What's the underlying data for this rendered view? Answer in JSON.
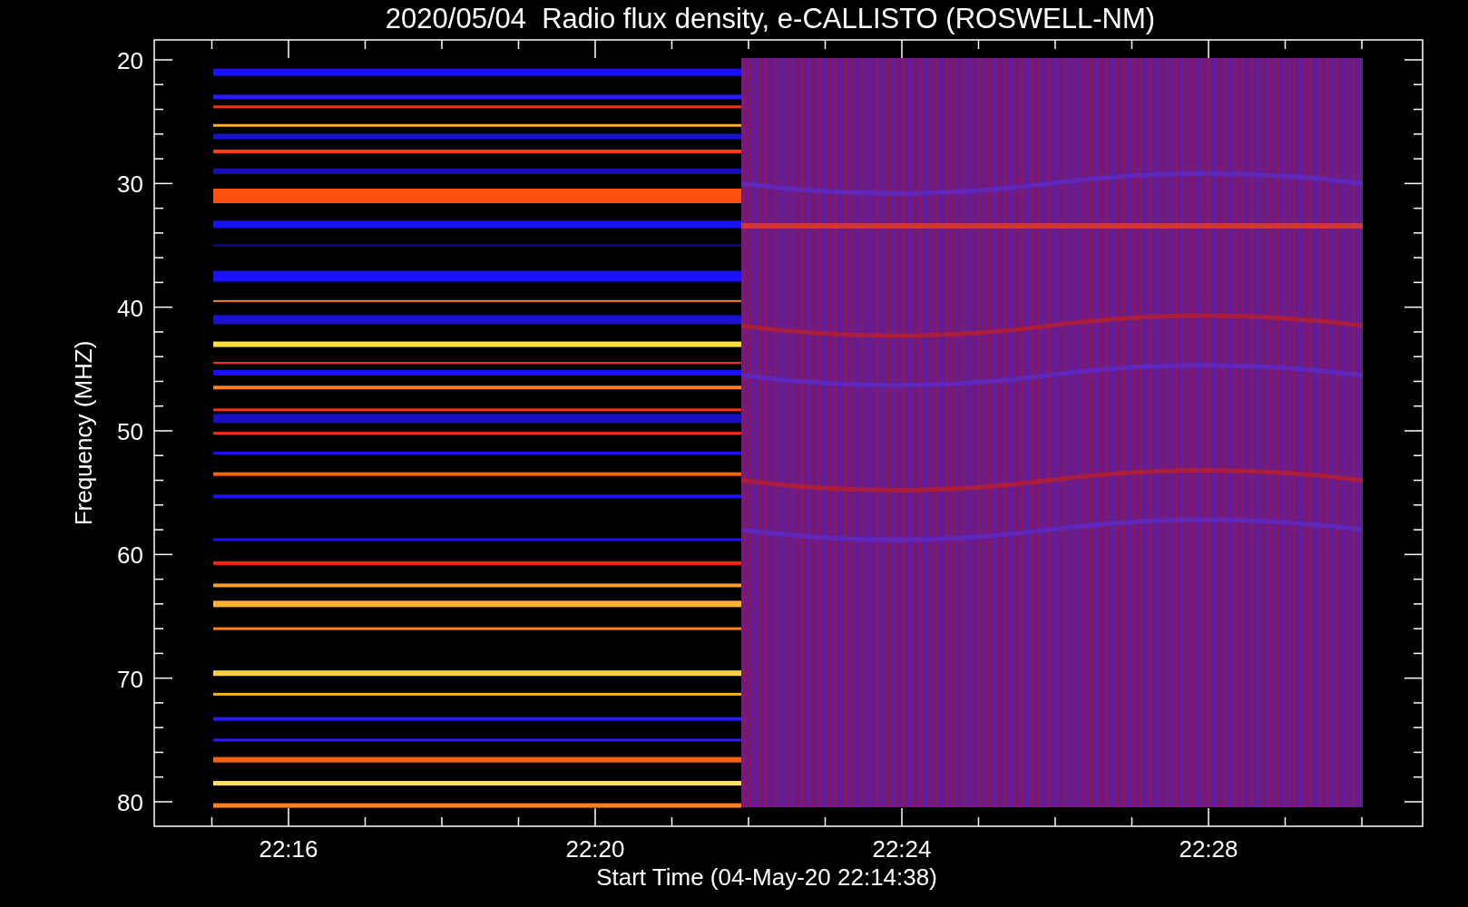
{
  "plot": {
    "title": "2020/05/04  Radio flux density, e-CALLISTO (ROSWELL-NM)",
    "ylabel": "Frequency (MHZ)",
    "xlabel": "Start Time (04-May-20 22:14:38)",
    "yticks": [
      "20",
      "30",
      "40",
      "50",
      "60",
      "70",
      "80"
    ],
    "xticks": [
      "22:16",
      "22:20",
      "22:24",
      "22:28"
    ]
  }
}
